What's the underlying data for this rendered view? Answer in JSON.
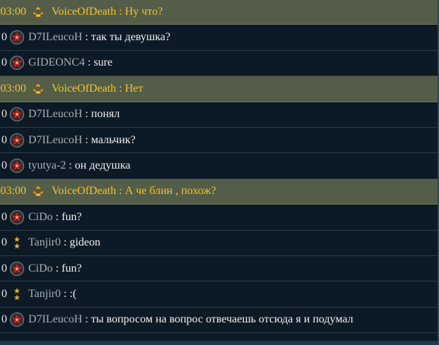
{
  "chat": {
    "messages": [
      {
        "highlight": true,
        "time": "03:00",
        "icon": "rank-gold-icon",
        "user": "VoiceOfDeath",
        "sep": " : ",
        "text": "Ну что?"
      },
      {
        "highlight": false,
        "time": "0",
        "icon": "red-star-icon",
        "user": "D7ILeucoH",
        "sep": " : ",
        "text": "так ты девушка?"
      },
      {
        "highlight": false,
        "time": "0",
        "icon": "red-star-icon",
        "user": "GIDEONC4",
        "sep": " : ",
        "text": "sure"
      },
      {
        "highlight": true,
        "time": "03:00",
        "icon": "rank-gold-icon",
        "user": "VoiceOfDeath",
        "sep": " : ",
        "text": "Нет"
      },
      {
        "highlight": false,
        "time": "0",
        "icon": "red-star-icon",
        "user": "D7ILeucoH",
        "sep": " : ",
        "text": "понял"
      },
      {
        "highlight": false,
        "time": "0",
        "icon": "red-star-icon",
        "user": "D7ILeucoH",
        "sep": " : ",
        "text": "мальчик?"
      },
      {
        "highlight": false,
        "time": "0",
        "icon": "red-star-icon",
        "user": "tyutya-2",
        "sep": " : ",
        "text": "он дедушка"
      },
      {
        "highlight": true,
        "time": "03:00",
        "icon": "rank-gold-icon",
        "user": "VoiceOfDeath",
        "sep": " : ",
        "text": "А че блин , похож?"
      },
      {
        "highlight": false,
        "time": "0",
        "icon": "red-star-icon",
        "user": "CiDo",
        "sep": " : ",
        "text": "fun?"
      },
      {
        "highlight": false,
        "time": "0",
        "icon": "gold-stars-icon",
        "user": "Tanjir0",
        "sep": " : ",
        "text": "gideon"
      },
      {
        "highlight": false,
        "time": "0",
        "icon": "red-star-icon",
        "user": "CiDo",
        "sep": " : ",
        "text": "fun?"
      },
      {
        "highlight": false,
        "time": "0",
        "icon": "gold-stars-icon",
        "user": "Tanjir0",
        "sep": " : ",
        "text": ":("
      },
      {
        "highlight": false,
        "time": "0",
        "icon": "red-star-icon",
        "user": "D7ILeucoH",
        "sep": " : ",
        "text": "ты вопросом на вопрос отвечаешь отсюда я и подумал"
      }
    ]
  },
  "colors": {
    "background": "#0c1a26",
    "highlight_row": "#535d48",
    "highlight_text": "#f4c430",
    "username": "#a9b0b4",
    "message_text": "#f2f2f2"
  }
}
